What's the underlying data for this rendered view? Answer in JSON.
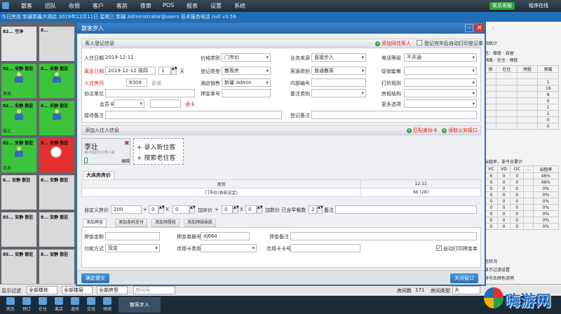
{
  "nav": {
    "items": [
      "散客",
      "团队",
      "收银",
      "客户",
      "客房",
      "夜审",
      "POS",
      "报表",
      "设置",
      "系统"
    ],
    "service_btn": "联系客服",
    "online_btn": "程序在线"
  },
  "statusbar": "今日房态 新疆聚鑫大酒店 2019年12月11日 星期三 新疆 Administrator@users 技术服务电话 null v3.59",
  "rooms": [
    {
      "num": "82...",
      "status": "空净",
      "tag": "",
      "name": "",
      "kind": "empty"
    },
    {
      "num": "8...",
      "status": "",
      "tag": "",
      "name": "",
      "kind": "dirty"
    },
    {
      "num": "82...",
      "status": "安静",
      "tag": "散驻",
      "name": "李浩",
      "kind": "busy"
    },
    {
      "num": "8...",
      "status": "安静",
      "tag": "散驻",
      "name": "",
      "kind": "busy"
    },
    {
      "num": "82...",
      "status": "安静",
      "tag": "散驻",
      "name": "张三",
      "kind": "busy"
    },
    {
      "num": "8...",
      "status": "安静",
      "tag": "散驻",
      "name": "",
      "kind": "busy"
    },
    {
      "num": "82...",
      "status": "安静",
      "tag": "散驻",
      "name": "王兵",
      "kind": "busy"
    },
    {
      "num": "8...",
      "status": "安静",
      "tag": "散驻",
      "name": "",
      "kind": "red"
    },
    {
      "num": "8...",
      "status": "安静",
      "tag": "散驻",
      "name": "",
      "kind": "dirty"
    },
    {
      "num": "8...",
      "status": "安静",
      "tag": "散驻",
      "name": "",
      "kind": "dirty"
    },
    {
      "num": "85...",
      "status": "安静",
      "tag": "散驻",
      "name": "",
      "kind": "dirty"
    },
    {
      "num": "8...",
      "status": "安静",
      "tag": "散驻",
      "name": "",
      "kind": "dirty"
    },
    {
      "num": "85...",
      "status": "安静",
      "tag": "散驻",
      "name": "",
      "kind": "dirty"
    },
    {
      "num": "8...",
      "status": "安静",
      "tag": "散驻",
      "name": "",
      "kind": "dirty"
    }
  ],
  "rightpanel": {
    "title1": "况统计",
    "title2": "态：维修 · 自留",
    "title3": "预离 · 在住 · 预抵",
    "cols1": [
      "房",
      "在住",
      "预抵",
      "预离"
    ],
    "rows1": [
      [
        "",
        "",
        "",
        ""
      ],
      [
        "",
        "",
        "",
        "1"
      ],
      [
        "",
        "",
        "",
        "19"
      ],
      [
        "",
        "",
        "",
        "8"
      ],
      [
        "",
        "",
        "",
        "0"
      ],
      [
        "",
        "",
        "",
        "1"
      ],
      [
        "",
        "",
        "",
        "1"
      ],
      [
        "",
        "",
        "",
        "0"
      ],
      [
        "",
        "",
        "",
        "0"
      ]
    ],
    "title4": "出租率，非今日累计",
    "cols2": [
      "VC",
      "VD",
      "OC",
      "…",
      "出租率"
    ],
    "rows2": [
      [
        "6",
        "0",
        "0",
        "",
        "46%"
      ],
      [
        "0",
        "0",
        "0",
        "",
        "46%"
      ],
      [
        "0",
        "0",
        "0",
        "",
        "0%"
      ],
      [
        "0",
        "0",
        "0",
        "",
        "0%"
      ],
      [
        "0",
        "0",
        "0",
        "",
        "0%"
      ],
      [
        "0",
        "0",
        "0",
        "",
        "0%"
      ],
      [
        "0",
        "0",
        "0",
        "",
        "0%"
      ],
      [
        "0",
        "0",
        "0",
        "",
        "0%"
      ],
      [
        "0",
        "0",
        "0",
        "",
        "0%"
      ]
    ],
    "foot1": "态状况",
    "foot2": "显示过滤设置",
    "foot3": "房号及颜色说明"
  },
  "filterbar": {
    "label": "显示过滤",
    "sel1": "全部楼栋",
    "sel2": "全部楼层",
    "sel3": "全部房型",
    "sel4": "房间号",
    "room_count_label": "房间数",
    "room_count": "171",
    "room_type_label": "房间类型",
    "room_type_value": "大"
  },
  "taskbar": {
    "items": [
      "房态",
      "预订",
      "在住",
      "离店",
      "退房",
      "交班",
      "预测"
    ],
    "active": "散客步入"
  },
  "watermark": "嗨游网",
  "dialog": {
    "title": "散客步入",
    "sec1": "客人登记信息",
    "link_same_room": "添加同住客人",
    "auto_print_label": "登记完毕后自动打印登记单",
    "checkin_date_label": "入住日期",
    "checkin_date": "2019-12-11",
    "checkout_date_label": "离店日期",
    "checkout_date": "2019-12-12 周四",
    "nights": "1",
    "nights_unit": "天",
    "room_label": "入住房间",
    "room_no": "8309",
    "change_label": "更换",
    "agreement_label": "协议单位",
    "member_card_label": "会员卡",
    "read_card_label": "读卡",
    "notes_label": "接待备注",
    "price_type_label": "价格类别",
    "price_type": "门市价",
    "reg_type_label": "登记类型",
    "reg_type": "散客房",
    "sales_label": "酒店销售",
    "sales": "新疆 Admin",
    "deposit_no_label": "押金单号",
    "source_label": "业务来源",
    "source": "直接步入",
    "cust_type_label": "客源类别",
    "cust_type": "普通散客",
    "internal_label": "内部编号",
    "backup_label": "备注类别",
    "phone_level_label": "电话等级",
    "phone_level": "不开通",
    "promo_label": "促销套餐",
    "discount_label": "打折规则",
    "room_struct_label": "房租结构",
    "more_label": "更多选项",
    "reg_note_label": "登记备注",
    "sec2": "添加入住人信息",
    "link_match_id": "匹配身份卡",
    "link_police": "读取公安接口",
    "guest_name": "李壮",
    "guest_sub": "第(中国)511男人民",
    "guest_edit": "编辑",
    "add_new": "+ 录入新住客",
    "search_old": "+ 搜索老住客",
    "price_tab": "大床房房价",
    "price_cols": [
      "类别",
      "12-11"
    ],
    "price_row": [
      "门市价(系统设定)",
      "66 (2B)"
    ],
    "custom_price_label": "自定义房价",
    "custom_price": "200",
    "val1": "0",
    "val2": "0",
    "add_bed_label": "加床价",
    "val3": "0",
    "val4": "0",
    "add_price_label": "加数价 已含早餐数",
    "breakfast": "2",
    "remarks_label": "备注",
    "subtabs": [
      "添加押金",
      "添加条码支付",
      "添加预授权",
      "添加预结收款"
    ],
    "deposit_amt_label": "押金金额",
    "deposit_no2_label": "押金单据号",
    "deposit_no2": "dj664",
    "deposit_remark_label": "押金备注",
    "pay_method_label": "付款方式",
    "pay_method": "现金",
    "credit_type_label": "信用卡类型",
    "credit_no_label": "信用卡卡号",
    "auto_print_deposit": "自动打印押金单",
    "confirm_btn": "确定提交",
    "close_btn": "关闭窗口"
  }
}
